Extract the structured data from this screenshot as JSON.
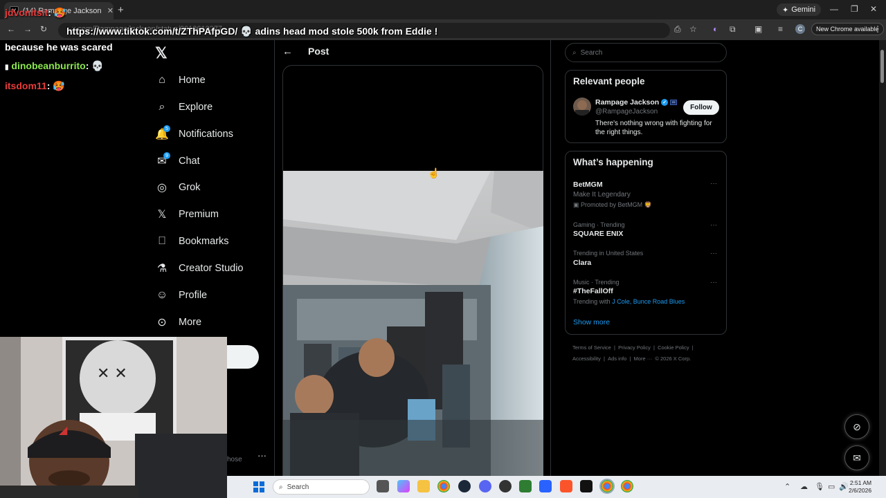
{
  "browser": {
    "tab_title": "(14) Rampage Jackson on X: \"i",
    "tab_favicon": "X",
    "tab_close": "✕",
    "new_tab": "+",
    "gemini_label": "Gemini",
    "url_faint": "x.com/RampageJackson/status/2019610377...",
    "new_chrome_label": "New Chrome available",
    "profile_initial": "C",
    "window_controls": [
      "—",
      "❐",
      "✕"
    ]
  },
  "overlay": {
    "url_text": "https://www.tiktok.com/t/ZThPAfpGD/ 💀 adins head mod stole 500k from Eddie !",
    "chat": [
      {
        "user": "jdvonitsit",
        "message": "🥵",
        "color": "#e83b3b"
      },
      {
        "user": "",
        "message": "because he was scared",
        "color": "#ffffff"
      },
      {
        "user": "dinobeanburrito",
        "message": "💀",
        "color": "#8be84e"
      },
      {
        "user": "itsdom11",
        "message": "🥵",
        "color": "#e83b3b"
      }
    ]
  },
  "sidebar": {
    "logo": "𝕏",
    "items": [
      {
        "label": "Home",
        "icon": "home-icon",
        "glyph": "⌂"
      },
      {
        "label": "Explore",
        "icon": "search-icon",
        "glyph": "⌕"
      },
      {
        "label": "Notifications",
        "icon": "bell-icon",
        "glyph": "🔔",
        "badge": "5"
      },
      {
        "label": "Chat",
        "icon": "mail-icon",
        "glyph": "✉",
        "badge": "9"
      },
      {
        "label": "Grok",
        "icon": "grok-icon",
        "glyph": "◎",
        "dot": true
      },
      {
        "label": "Premium",
        "icon": "x-premium-icon",
        "glyph": "𝕏"
      },
      {
        "label": "Bookmarks",
        "icon": "bookmark-icon",
        "glyph": "⎕"
      },
      {
        "label": "Creator Studio",
        "icon": "flask-icon",
        "glyph": "⚗"
      },
      {
        "label": "Profile",
        "icon": "person-icon",
        "glyph": "☺"
      },
      {
        "label": "More",
        "icon": "more-circle-icon",
        "glyph": "⊙"
      }
    ],
    "account_hint": "hose",
    "account_more": "···"
  },
  "main": {
    "back": "←",
    "title": "Post"
  },
  "right": {
    "search_placeholder": "Search",
    "relevant": {
      "heading": "Relevant people",
      "name": "Rampage Jackson",
      "handle": "@RampageJackson",
      "bio": "There's nothing wrong with fighting for the right things.",
      "follow_label": "Follow"
    },
    "happening": {
      "heading": "What’s happening",
      "trends": [
        {
          "meta": "",
          "name": "BetMGM",
          "sub": "Make It Legendary",
          "promo": "Promoted by BetMGM 🦁"
        },
        {
          "meta": "Gaming · Trending",
          "name": "SQUARE ENIX",
          "sub": ""
        },
        {
          "meta": "Trending in United States",
          "name": "Clara",
          "sub": ""
        },
        {
          "meta": "Music · Trending",
          "name": "#TheFallOff",
          "sub": "Trending with",
          "links": "J Cole, Bunce Road Blues"
        }
      ],
      "more_glyph": "···",
      "show_more": "Show more"
    },
    "footer": {
      "row1": [
        "Terms of Service",
        "|",
        "Privacy Policy",
        "|",
        "Cookie Policy",
        "|"
      ],
      "row2": [
        "Accessibility",
        "|",
        "Ads info",
        "|",
        "More ···",
        "© 2026 X Corp."
      ]
    }
  },
  "taskbar": {
    "search_label": "Search",
    "time": "2:51 AM",
    "date": "2/6/2026"
  },
  "colors": {
    "accent": "#1d9bf0",
    "border": "#2f3336",
    "muted": "#71767b",
    "text": "#e7e9ea"
  }
}
